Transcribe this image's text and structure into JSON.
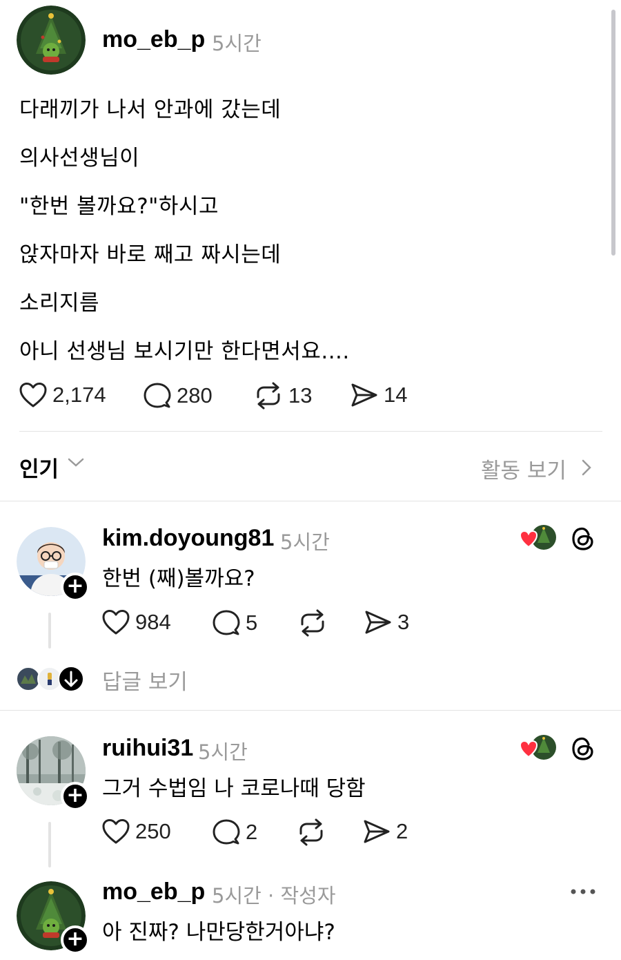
{
  "post": {
    "username": "mo_eb_p",
    "time": "5시간",
    "lines": [
      "다래끼가 나서 안과에 갔는데",
      "의사선생님이",
      "\"한번 볼까요?\"하시고",
      "앉자마자 바로 째고 짜시는데",
      "소리지름",
      "아니 선생님 보시기만 한다면서요...."
    ],
    "likes": "2,174",
    "comments": "280",
    "reposts": "13",
    "shares": "14"
  },
  "sort": {
    "label": "인기",
    "activity_label": "활동 보기"
  },
  "replies": [
    {
      "username": "kim.doyoung81",
      "time": "5시간",
      "text": "한번 (째)볼까요?",
      "likes": "984",
      "comments": "5",
      "reposts": "",
      "shares": "3",
      "view_replies_label": "답글 보기"
    },
    {
      "username": "ruihui31",
      "time": "5시간",
      "text": "그거 수법임 나 코로나때 당함",
      "likes": "250",
      "comments": "2",
      "reposts": "",
      "shares": "2"
    },
    {
      "username": "mo_eb_p",
      "time": "5시간",
      "author_tag": "· 작성자",
      "text": "아 진짜? 나만당한거아냐?"
    }
  ],
  "icons": {
    "like": "heart-icon",
    "comment": "comment-bubble-icon",
    "repost": "repost-icon",
    "share": "send-icon",
    "threads": "threads-logo-icon",
    "follow": "plus-icon",
    "more": "more-dots-icon"
  },
  "colors": {
    "text": "#000000",
    "muted": "#9a9a9a",
    "divider": "#e3e3e3",
    "liked_heart": "#ff3040"
  }
}
